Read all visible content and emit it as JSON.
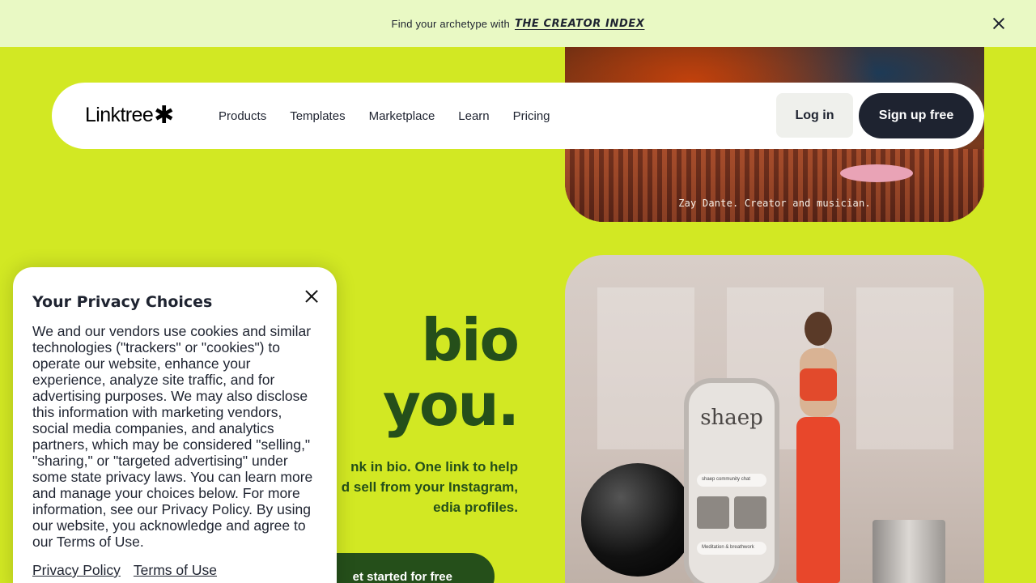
{
  "banner": {
    "text": "Find your archetype with",
    "brand": "THE CREATOR INDEX",
    "close_icon": "close-icon"
  },
  "navbar": {
    "logo_text": "Linktree",
    "logo_mark": "✱",
    "links": [
      "Products",
      "Templates",
      "Marketplace",
      "Learn",
      "Pricing"
    ],
    "login_label": "Log in",
    "signup_label": "Sign up free"
  },
  "hero": {
    "heading_line1": "bio",
    "heading_line2": "you.",
    "sub_line1": "nk in bio. One link to help",
    "sub_line2": "d sell from your Instagram,",
    "sub_line3": "edia profiles.",
    "cta_label": "et started for free",
    "photo_top_caption": "Zay Dante. Creator and musician.",
    "phone_title": "shaep",
    "phone_row1": "shaep community chat",
    "phone_row2": "Meditation & breathwork"
  },
  "privacy": {
    "title": "Your Privacy Choices",
    "body": "We and our vendors use cookies and similar technologies (\"trackers\" or \"cookies\") to operate our website, enhance your experience, analyze site traffic, and for advertising purposes. We may also disclose this information with marketing vendors, social media companies, and analytics partners, which may be considered \"selling,\" \"sharing,\" or \"targeted advertising\" under some state privacy laws. You can learn more and manage your choices below. For more information, see our Privacy Policy. By using our website, you acknowledge and agree to our Terms of Use.",
    "link_policy": "Privacy Policy",
    "link_terms": "Terms of Use"
  },
  "colors": {
    "background": "#d2e823",
    "banner_bg": "#e9f9c4",
    "dark": "#1e2330",
    "hero_green": "#254f1a"
  }
}
